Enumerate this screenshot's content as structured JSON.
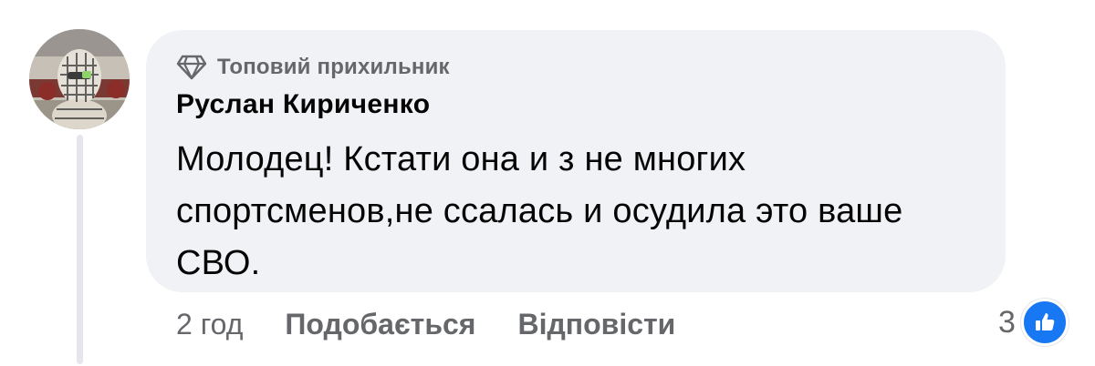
{
  "comment": {
    "badge_label": "Топовий прихильник",
    "badge_icon": "diamond-icon",
    "author": "Руслан Кириченко",
    "text": "Молодец! Кстати она и з не многих спортсменов,не ссалась и осудила это ваше СВО.",
    "timestamp": "2 год",
    "like_label": "Подобається",
    "reply_label": "Відповісти",
    "reaction_count": "3",
    "reaction_icon": "like-icon"
  },
  "colors": {
    "bubble_bg": "#f0f2f5",
    "secondary_text": "#65676b",
    "primary_text": "#050505",
    "like_blue": "#1877f2",
    "thread_line": "#e4e6eb"
  }
}
